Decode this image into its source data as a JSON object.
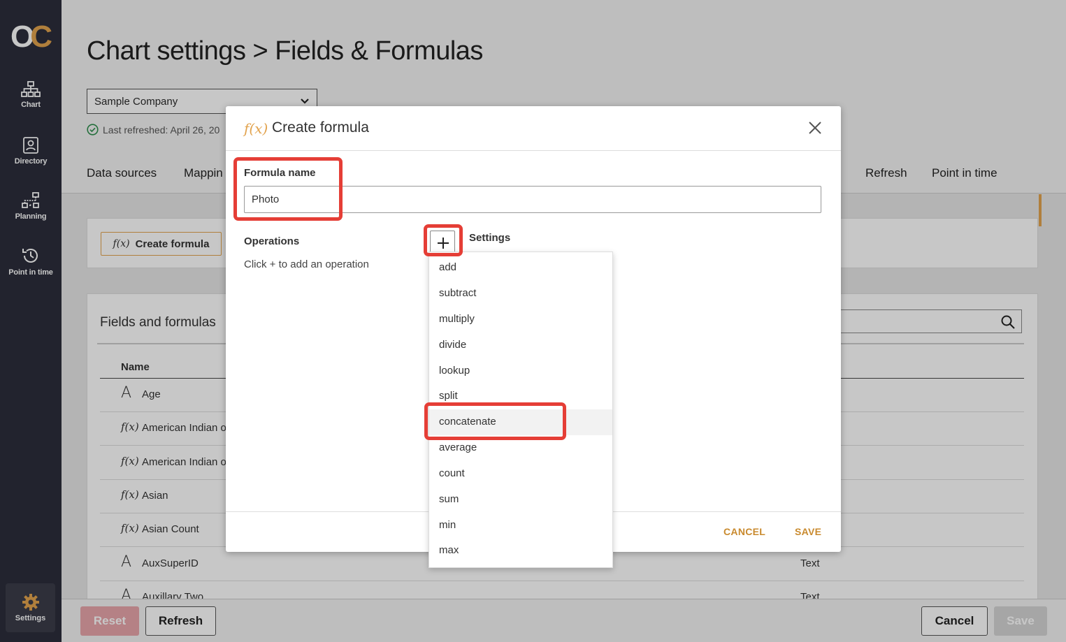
{
  "sidebar": {
    "logo": {
      "o": "O",
      "c": "C"
    },
    "items": [
      {
        "label": "Chart",
        "icon": "org-chart-icon"
      },
      {
        "label": "Directory",
        "icon": "directory-icon"
      },
      {
        "label": "Planning",
        "icon": "planning-icon"
      },
      {
        "label": "Point in time",
        "icon": "history-icon"
      }
    ],
    "settings": {
      "label": "Settings",
      "icon": "gear-icon"
    }
  },
  "page": {
    "title": "Chart settings > Fields & Formulas",
    "company": "Sample Company",
    "last_refreshed": "Last refreshed: April 26, 20"
  },
  "tabs": [
    {
      "label": "Data sources"
    },
    {
      "label": "Mappin"
    },
    {
      "label": "Refresh"
    },
    {
      "label": "Point in time"
    }
  ],
  "create_formula_button": "Create formula",
  "fields": {
    "title": "Fields and formulas",
    "column_name": "Name",
    "rows": [
      {
        "icon": "A",
        "name": "Age",
        "type": ""
      },
      {
        "icon": "f(x)",
        "name": "American Indian o",
        "type": ""
      },
      {
        "icon": "f(x)",
        "name": "American Indian o",
        "type": ""
      },
      {
        "icon": "f(x)",
        "name": "Asian",
        "type": ""
      },
      {
        "icon": "f(x)",
        "name": "Asian Count",
        "type": ""
      },
      {
        "icon": "A",
        "name": "AuxSuperID",
        "type": "Text"
      },
      {
        "icon": "A",
        "name": "Auxillary Two",
        "type": "Text"
      }
    ]
  },
  "footer": {
    "reset": "Reset",
    "refresh": "Refresh",
    "cancel": "Cancel",
    "save": "Save"
  },
  "modal": {
    "fx_icon": "f(x)",
    "title": "Create formula",
    "formula_name_label": "Formula name",
    "formula_name_value": "Photo",
    "operations_label": "Operations",
    "operations_hint": "Click + to add an operation",
    "settings_label": "Settings",
    "cancel": "CANCEL",
    "save": "SAVE"
  },
  "dropdown": {
    "selected": "concatenate",
    "options": [
      "add",
      "subtract",
      "multiply",
      "divide",
      "lookup",
      "split",
      "concatenate",
      "average",
      "count",
      "sum",
      "min",
      "max"
    ]
  },
  "colors": {
    "sidebar": "#2c2e3b",
    "accent": "#e2a34e",
    "highlight": "#e53e36"
  }
}
